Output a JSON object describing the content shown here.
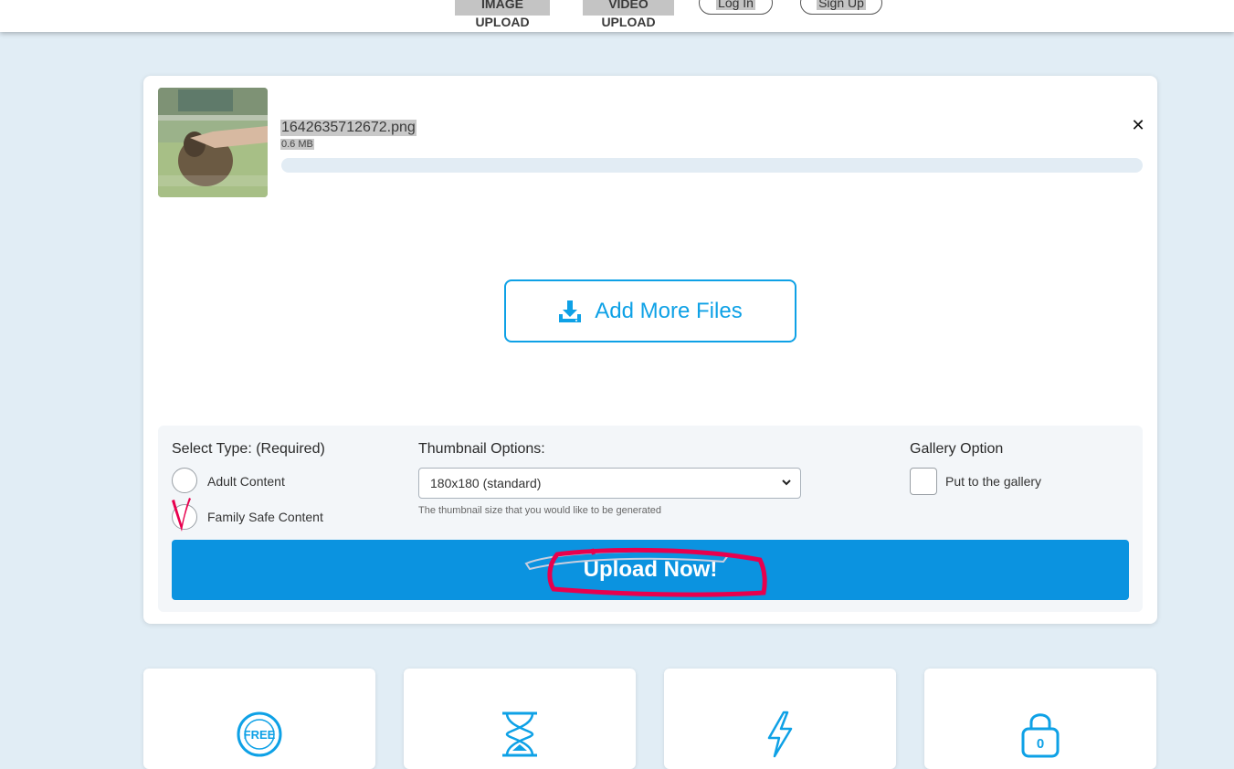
{
  "nav": {
    "image_upload": "IMAGE UPLOAD",
    "video_upload": "VIDEO UPLOAD",
    "login": "Log In",
    "signup": "Sign Up"
  },
  "file": {
    "name": "1642635712672.png",
    "size": "0.6 MB",
    "progress": 0
  },
  "add_files_label": "Add More Files",
  "options": {
    "type_title": "Select Type: (Required)",
    "adult_label": "Adult Content",
    "family_label": "Family Safe Content",
    "thumb_title": "Thumbnail Options:",
    "thumb_value": "180x180 (standard)",
    "thumb_hint": "The thumbnail size that you would like to be generated",
    "gallery_title": "Gallery Option",
    "gallery_label": "Put to the gallery"
  },
  "upload_label": "Upload Now!",
  "features": {
    "free_badge": "FREE",
    "lock_badge": "0"
  },
  "colors": {
    "accent": "#0b93e0",
    "annotation": "#e8004e",
    "page_bg": "#e1edf5"
  }
}
